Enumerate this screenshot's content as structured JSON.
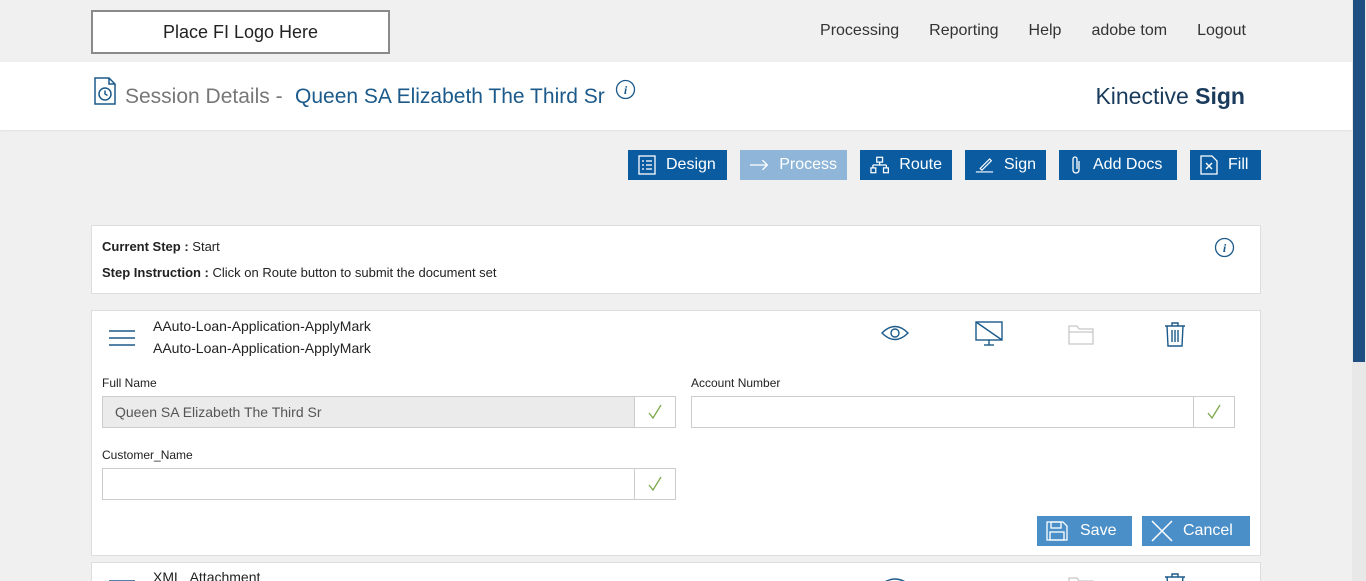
{
  "logo": {
    "text": "Place FI Logo Here"
  },
  "nav": {
    "items": [
      "Processing",
      "Reporting",
      "Help",
      "adobe tom",
      "Logout"
    ]
  },
  "header": {
    "session_label": "Session Details -",
    "session_name": "Queen SA Elizabeth The Third Sr",
    "brand_regular": "Kinective",
    "brand_bold": "Sign"
  },
  "toolbar": {
    "design": "Design",
    "process": "Process",
    "route": "Route",
    "sign": "Sign",
    "add_docs": "Add Docs",
    "fill": "Fill"
  },
  "step": {
    "current_label": "Current Step :",
    "current_value": "Start",
    "instruction_label": "Step Instruction :",
    "instruction_value": "Click on Route button to submit the document set"
  },
  "document": {
    "title_line1": "AAuto-Loan-Application-ApplyMark",
    "title_line2": "AAuto-Loan-Application-ApplyMark",
    "fields": {
      "full_name_label": "Full Name",
      "full_name_value": "Queen SA Elizabeth The Third Sr",
      "account_number_label": "Account Number",
      "account_number_value": "",
      "customer_name_label": "Customer_Name",
      "customer_name_value": ""
    },
    "save_label": "Save",
    "cancel_label": "Cancel"
  },
  "document2": {
    "title": "XML_Attachment"
  },
  "colors": {
    "primary": "#0a5ba0",
    "primary_disabled": "#8fb6d8",
    "secondary_button": "#4a8fc8",
    "session_name": "#1b5a8a",
    "check": "#7aa84a"
  }
}
